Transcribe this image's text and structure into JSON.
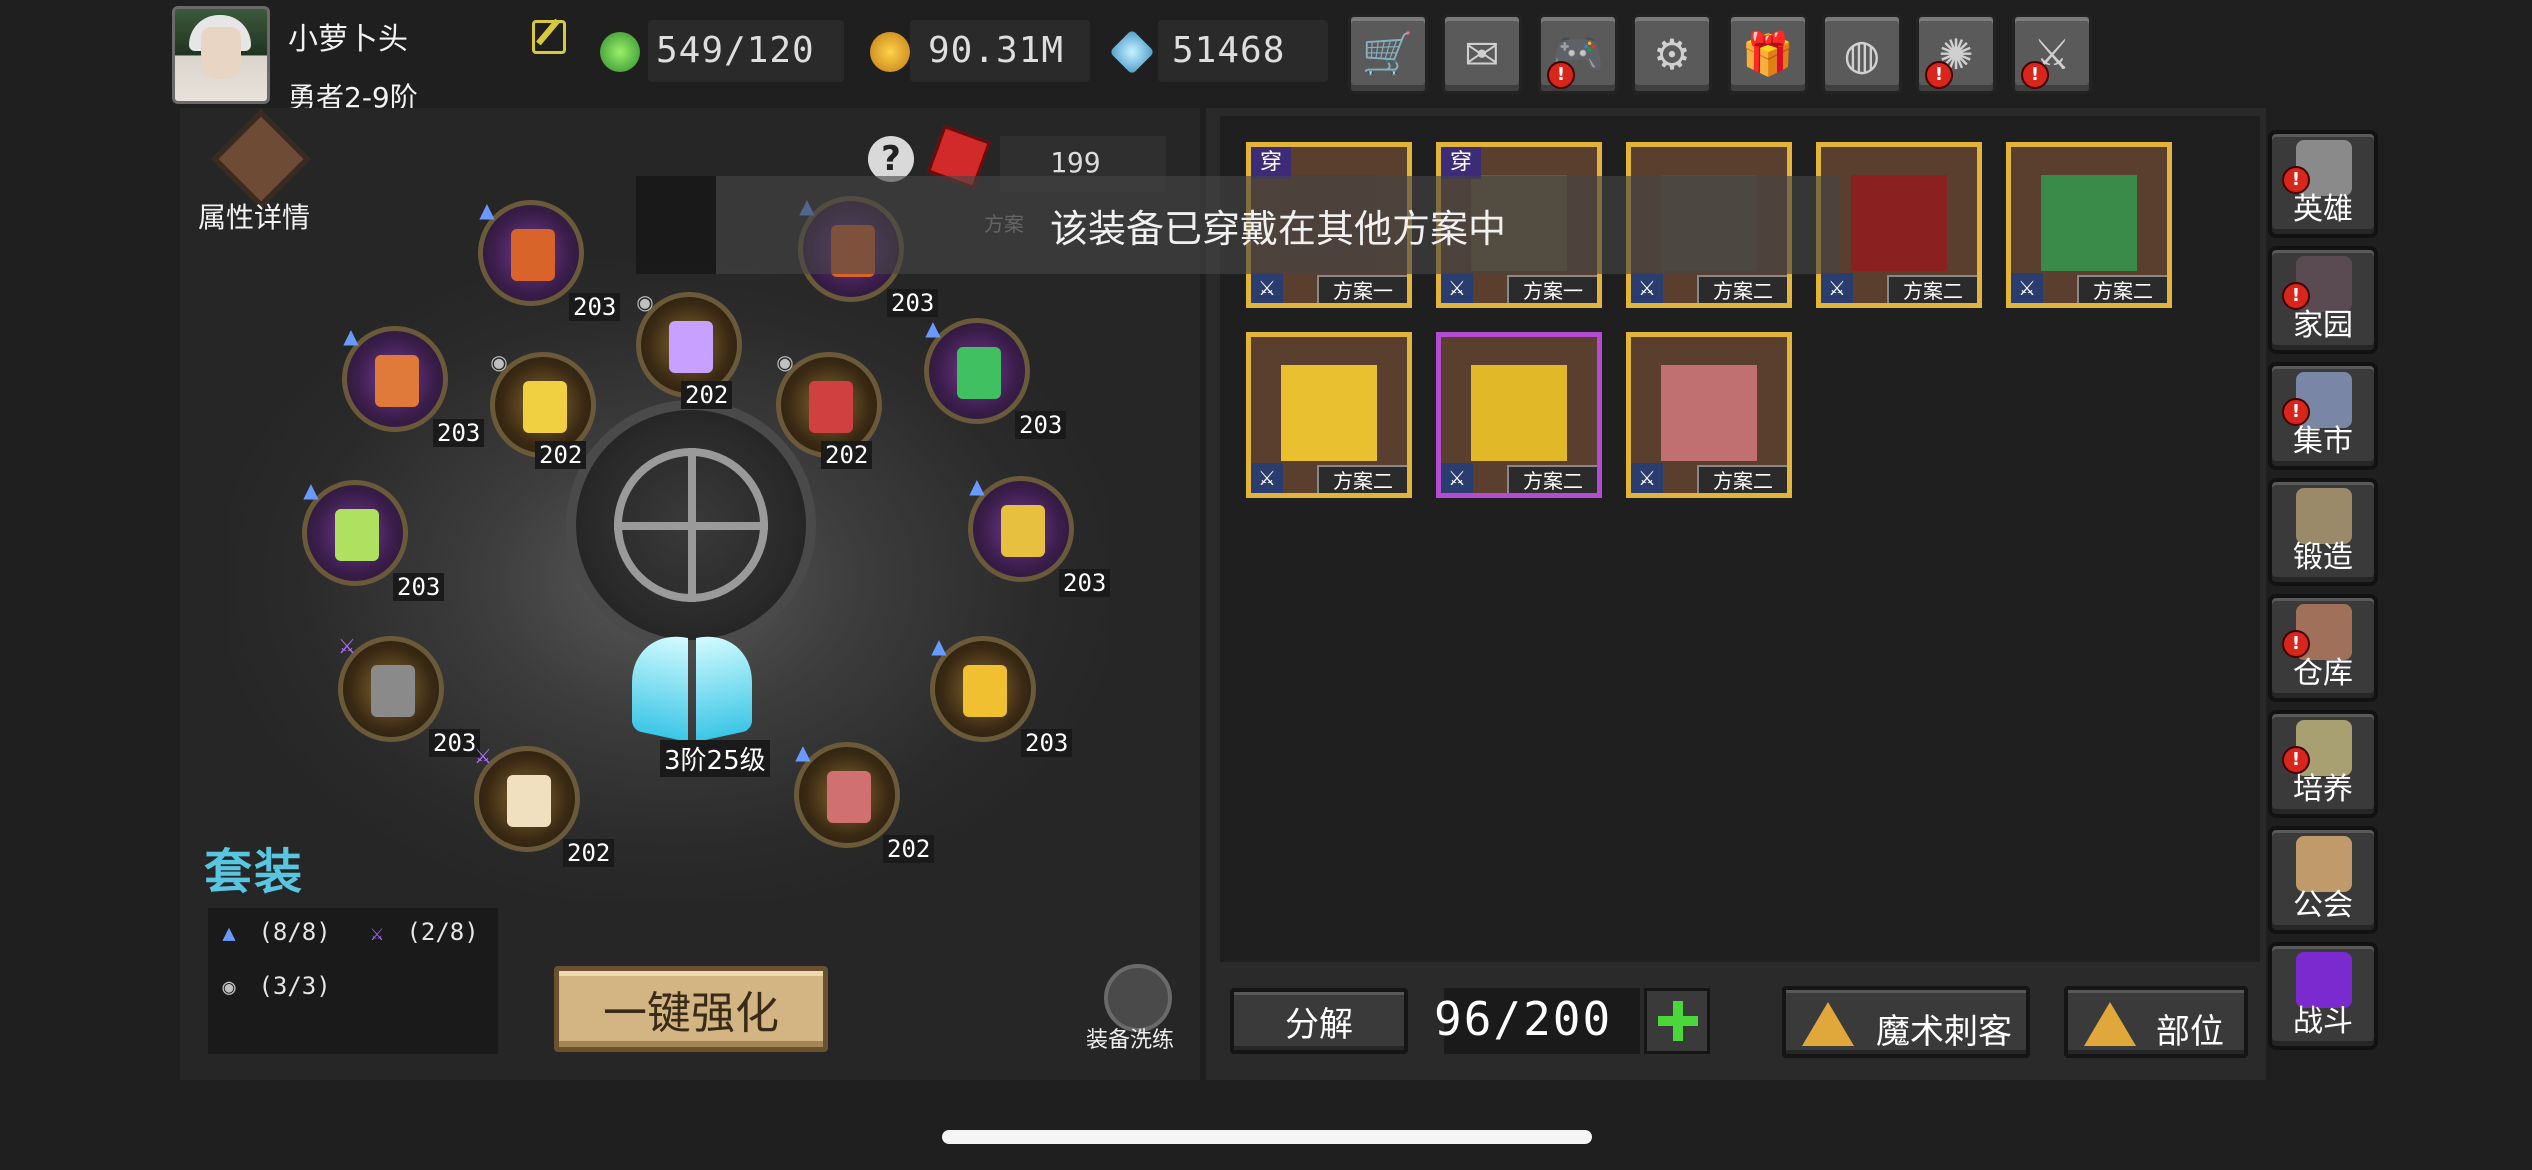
{
  "player": {
    "name": "小萝卜头",
    "rank": "勇者2-9阶"
  },
  "resources": {
    "energy": "549/120",
    "gold": "90.31M",
    "diamond": "51468"
  },
  "toolbar": [
    {
      "name": "shop-button",
      "icon": "cart-icon",
      "glyph": "🛒",
      "alert": false
    },
    {
      "name": "mail-button",
      "icon": "mail-icon",
      "glyph": "✉",
      "alert": false
    },
    {
      "name": "game-button",
      "icon": "gamepad-icon",
      "glyph": "🎮",
      "alert": true
    },
    {
      "name": "settings-button",
      "icon": "gear-icon",
      "glyph": "⚙",
      "alert": false
    },
    {
      "name": "gift-button",
      "icon": "gift-icon",
      "glyph": "🎁",
      "alert": false
    },
    {
      "name": "wheel-button",
      "icon": "color-wheel-icon",
      "glyph": "◍",
      "alert": false
    },
    {
      "name": "firework-button",
      "icon": "firework-icon",
      "glyph": "✺",
      "alert": true
    },
    {
      "name": "battle-pass-button",
      "icon": "crossed-swords-icon",
      "glyph": "⚔",
      "alert": true
    }
  ],
  "left": {
    "attr_label": "属性详情",
    "gem_count": "199",
    "wing_label": "3阶25级",
    "set_title": "套装",
    "set_bonuses": [
      {
        "icon": "mountain-set-icon",
        "glyph": "▲",
        "text": "(8/8)"
      },
      {
        "icon": "crossed-swords-set-icon",
        "glyph": "⚔",
        "text": "(2/8)"
      },
      {
        "icon": "eye-set-icon",
        "glyph": "◉",
        "text": "(3/3)"
      }
    ],
    "enhance_label": "一键强化",
    "refine_label": "装备洗练",
    "slots": [
      {
        "name": "slot-bow",
        "level": "203",
        "set": "▲"
      },
      {
        "name": "slot-staff-top",
        "level": "203",
        "set": "▲"
      },
      {
        "name": "slot-ring-top",
        "level": "202",
        "set": "◉"
      },
      {
        "name": "slot-crossbow",
        "level": "203",
        "set": "▲"
      },
      {
        "name": "slot-bracer",
        "level": "202",
        "set": "◉"
      },
      {
        "name": "slot-amulet",
        "level": "202",
        "set": "◉"
      },
      {
        "name": "slot-scythe",
        "level": "203",
        "set": "▲"
      },
      {
        "name": "slot-book",
        "level": "203",
        "set": "▲"
      },
      {
        "name": "slot-wand",
        "level": "203",
        "set": "▲"
      },
      {
        "name": "slot-helmet",
        "level": "203",
        "set": "⚔"
      },
      {
        "name": "slot-armor",
        "level": "203",
        "set": "▲"
      },
      {
        "name": "slot-belt",
        "level": "202",
        "set": "⚔"
      },
      {
        "name": "slot-boots",
        "level": "202",
        "set": "▲"
      }
    ]
  },
  "toast": {
    "message": "该装备已穿戴在其他方案中",
    "faded_tag": "方案"
  },
  "inventory": {
    "wear_tag": "穿",
    "items": [
      {
        "name": "item-bow",
        "plan": "方案一",
        "worn": true,
        "rarity": "legend"
      },
      {
        "name": "item-amulet",
        "plan": "方案一",
        "worn": true,
        "rarity": "legend"
      },
      {
        "name": "item-crossbow",
        "plan": "方案二",
        "worn": false,
        "rarity": "legend"
      },
      {
        "name": "item-spear",
        "plan": "方案二",
        "worn": false,
        "rarity": "legend"
      },
      {
        "name": "item-scythe",
        "plan": "方案二",
        "worn": false,
        "rarity": "legend"
      },
      {
        "name": "item-tome",
        "plan": "方案二",
        "worn": false,
        "rarity": "legend"
      },
      {
        "name": "item-chestplate",
        "plan": "方案二",
        "worn": false,
        "rarity": "epic"
      },
      {
        "name": "item-boots",
        "plan": "方案二",
        "worn": false,
        "rarity": "legend"
      }
    ],
    "decompose_label": "分解",
    "capacity": "96/200",
    "class_filter": "魔术刺客",
    "slot_filter": "部位"
  },
  "side_nav": [
    {
      "name": "nav-hero",
      "label": "英雄",
      "alert": true,
      "color": "#8a8a8a"
    },
    {
      "name": "nav-home",
      "label": "家园",
      "alert": true,
      "color": "#5a4a52"
    },
    {
      "name": "nav-market",
      "label": "集市",
      "alert": true,
      "color": "#7a86a6"
    },
    {
      "name": "nav-forge",
      "label": "锻造",
      "alert": false,
      "color": "#9a8a6a"
    },
    {
      "name": "nav-warehouse",
      "label": "仓库",
      "alert": true,
      "color": "#a0705a"
    },
    {
      "name": "nav-train",
      "label": "培养",
      "alert": true,
      "color": "#a8a070"
    },
    {
      "name": "nav-guild",
      "label": "公会",
      "alert": false,
      "color": "#c09a6a"
    },
    {
      "name": "nav-battle",
      "label": "战斗",
      "alert": false,
      "color": "#7b2ad0"
    }
  ]
}
